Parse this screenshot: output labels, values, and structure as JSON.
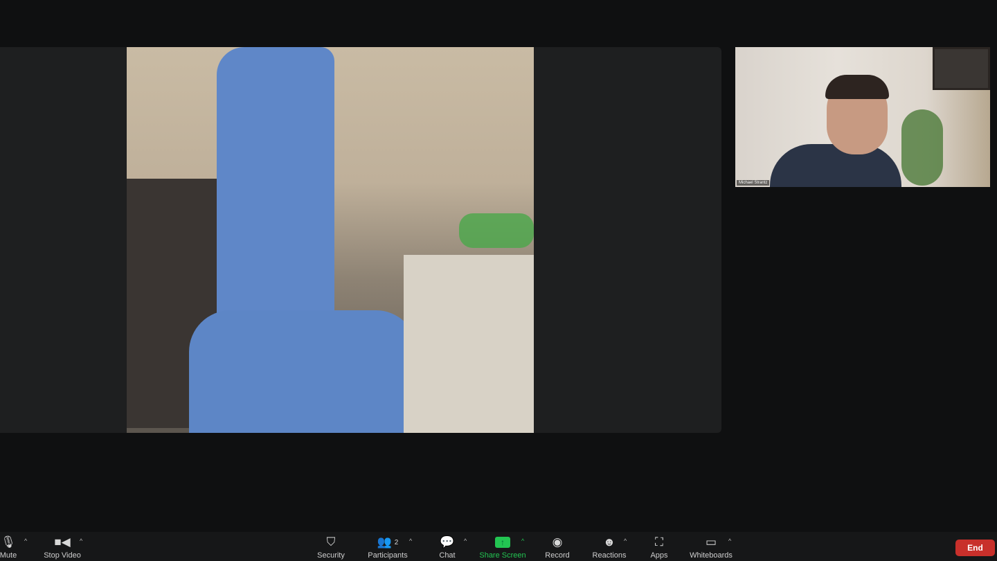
{
  "participants": {
    "thumbnail_name": "Michael Strantz"
  },
  "toolbar": {
    "mute": "Mute",
    "stop_video": "Stop Video",
    "security": "Security",
    "participants": "Participants",
    "participants_count": "2",
    "chat": "Chat",
    "share_screen": "Share Screen",
    "record": "Record",
    "reactions": "Reactions",
    "apps": "Apps",
    "whiteboards": "Whiteboards",
    "end": "End"
  },
  "colors": {
    "share_green": "#23c552",
    "end_red": "#c8302b"
  }
}
